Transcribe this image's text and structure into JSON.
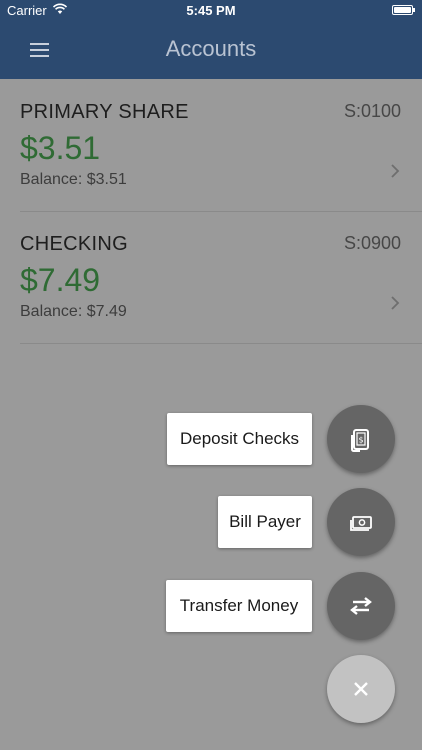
{
  "status_bar": {
    "carrier": "Carrier",
    "time": "5:45 PM"
  },
  "nav": {
    "title": "Accounts",
    "menu_icon": "hamburger-menu-icon"
  },
  "accounts": [
    {
      "name": "PRIMARY SHARE",
      "id": "S:0100",
      "amount": "$3.51",
      "balance": "Balance: $3.51"
    },
    {
      "name": "CHECKING",
      "id": "S:0900",
      "amount": "$7.49",
      "balance": "Balance: $7.49"
    }
  ],
  "actions": {
    "deposit_checks": {
      "label": "Deposit Checks",
      "icon": "deposit-check-icon"
    },
    "bill_payer": {
      "label": "Bill Payer",
      "icon": "cash-icon"
    },
    "transfer_money": {
      "label": "Transfer Money",
      "icon": "transfer-arrows-icon"
    },
    "close": {
      "icon": "close-icon"
    }
  },
  "colors": {
    "nav_background": "#2c4a70",
    "overlay_background": "#9a9a9a",
    "amount_green": "#2f6b34",
    "fab_dark": "#656565",
    "fab_close": "#c2c2c2"
  }
}
